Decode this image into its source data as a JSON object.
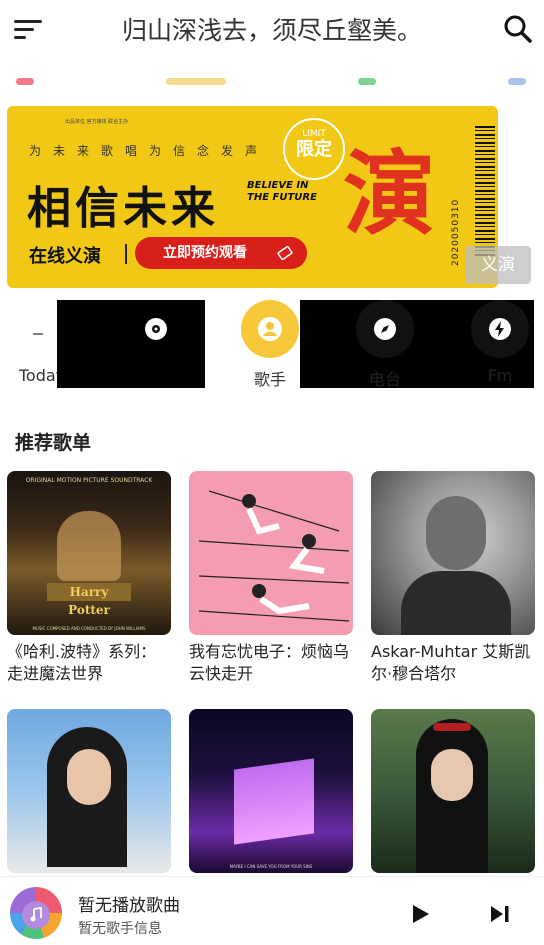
{
  "header": {
    "title": "归山深浅去，须尽丘壑美。",
    "menu_icon": "menu-icon",
    "search_icon": "search-icon"
  },
  "banner_dots": [
    "#f07a8d",
    "#f5da8c",
    "#7ed38e",
    "#a9c2f0"
  ],
  "banner": {
    "small_text": "出品单位 官方媒体 联合主办",
    "slogan": "为未来歌唱为信念发声",
    "headline": "相信未来",
    "english": "BELIEVE IN THE FUTURE",
    "live_label": "在线义演",
    "cta": "立即预约观看",
    "badge_top": "LIMIT",
    "badge_main": "限定",
    "serial": "2020050310",
    "art_glyph": "演",
    "tag": "义演",
    "colors": {
      "background": "#f1c815",
      "button": "#d91f1a",
      "accent": "#e0321f"
    }
  },
  "categories": [
    {
      "label": "Today",
      "icon": "today-icon",
      "active": false
    },
    {
      "label": "",
      "icon": "disc-icon",
      "active": false
    },
    {
      "label": "歌手",
      "icon": "singer-icon",
      "active": true
    },
    {
      "label": "电台",
      "icon": "compass-icon",
      "active": false
    },
    {
      "label": "Fm",
      "icon": "bolt-icon",
      "active": false
    }
  ],
  "section": {
    "title": "推荐歌单"
  },
  "playlists": [
    {
      "title": "《哈利.波特》系列：走进魔法世界",
      "art": "harry-potter-cover",
      "cover_text": "ORIGINAL MOTION PICTURE SOUNDTRACK",
      "cover_sub": "MUSIC COMPOSED AND CONDUCTED BY JOHN WILLIAMS"
    },
    {
      "title": "我有忘忧电子：烦恼乌云快走开",
      "art": "swing-illustration"
    },
    {
      "title": "Askar-Muhtar 艾斯凯尔·穆合塔尔",
      "art": "bw-portrait"
    },
    {
      "title": "",
      "art": "girl-portrait"
    },
    {
      "title": "",
      "art": "purple-window",
      "cover_text": "MAYBE I CAN SAVE YOU FROM YOUR SINS"
    },
    {
      "title": "",
      "art": "ancient-costume-portrait"
    }
  ],
  "player": {
    "song": "暂无播放歌曲",
    "artist": "暂无歌手信息",
    "play_icon": "play-icon",
    "next_icon": "next-icon"
  }
}
